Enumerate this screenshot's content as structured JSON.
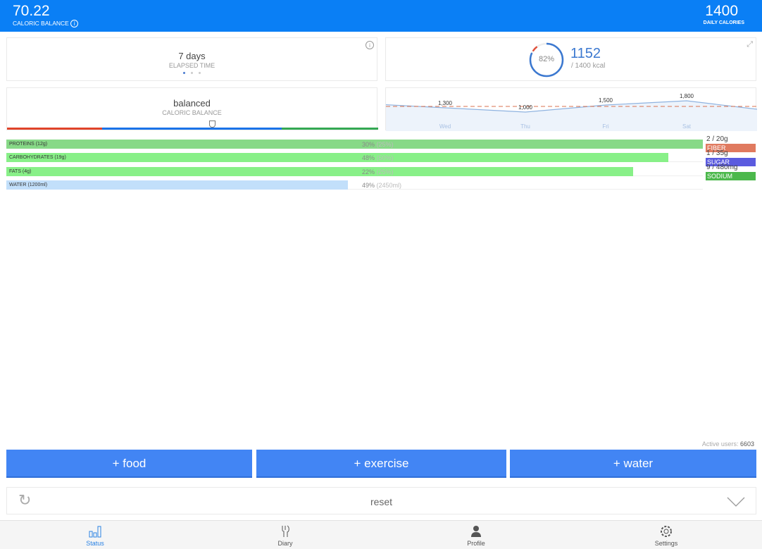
{
  "header": {
    "balance_value": "70.22",
    "balance_label": "CALORIC BALANCE",
    "daily_value": "1400",
    "daily_label": "DAILY CALORIES"
  },
  "elapsed": {
    "value": "7 days",
    "label": "ELAPSED TIME",
    "page_dots": 3,
    "active_dot": 1
  },
  "intake": {
    "percent": 82,
    "percent_label": "82%",
    "consumed": "1152",
    "goal": "/ 1400 kcal"
  },
  "balance_card": {
    "value": "balanced",
    "label": "CALORIC BALANCE",
    "colors": [
      "#e0442a",
      "#1a73e8",
      "#34a853"
    ]
  },
  "chart_data": {
    "type": "line",
    "categories": [
      "Wed",
      "Thu",
      "Fri",
      "Sat"
    ],
    "values": [
      1300,
      1000,
      1500,
      1800
    ],
    "data_labels": [
      "1,300",
      "1,000",
      "1,500",
      "1,800"
    ],
    "target": 1400,
    "target_style": "dashed",
    "line_color": "#8fb3e0",
    "fill_color": "#edf3fb",
    "target_color": "#d9714f"
  },
  "macros": [
    {
      "label": "PROTEINS (12g)",
      "pct": "30%",
      "target": "(25%)",
      "fill": 100,
      "color": "#87d987"
    },
    {
      "label": "CARBOHYDRATES (19g)",
      "pct": "48%",
      "target": "(50%)",
      "fill": 95,
      "color": "#88f088"
    },
    {
      "label": "FATS (4g)",
      "pct": "22%",
      "target": "(25%)",
      "fill": 90,
      "color": "#88f088"
    },
    {
      "label": "WATER (1200ml)",
      "pct": "49%",
      "target": "(2450ml)",
      "fill": 49,
      "color": "#c2dffa"
    }
  ],
  "micros": [
    {
      "value": "2 / 20g",
      "label": "FIBER",
      "color": "#e07a5f"
    },
    {
      "value": "1 / 35g",
      "label": "SUGAR",
      "color": "#5b5bdf"
    },
    {
      "value": "9 / 480mg",
      "label": "SODIUM",
      "color": "#4cb84c"
    }
  ],
  "active_users": {
    "label": "Active users:",
    "value": "6603"
  },
  "actions": {
    "food": "+ food",
    "exercise": "+ exercise",
    "water": "+ water"
  },
  "reset": {
    "label": "reset"
  },
  "tabs": [
    {
      "label": "Status",
      "icon": "bar-chart-icon",
      "active": true
    },
    {
      "label": "Diary",
      "icon": "fork-knife-icon"
    },
    {
      "label": "Profile",
      "icon": "person-icon"
    },
    {
      "label": "Settings",
      "icon": "gear-icon"
    }
  ],
  "colors": {
    "header": "#0a7ff5",
    "accent": "#4285f4",
    "tab_active": "#2a82e4"
  }
}
